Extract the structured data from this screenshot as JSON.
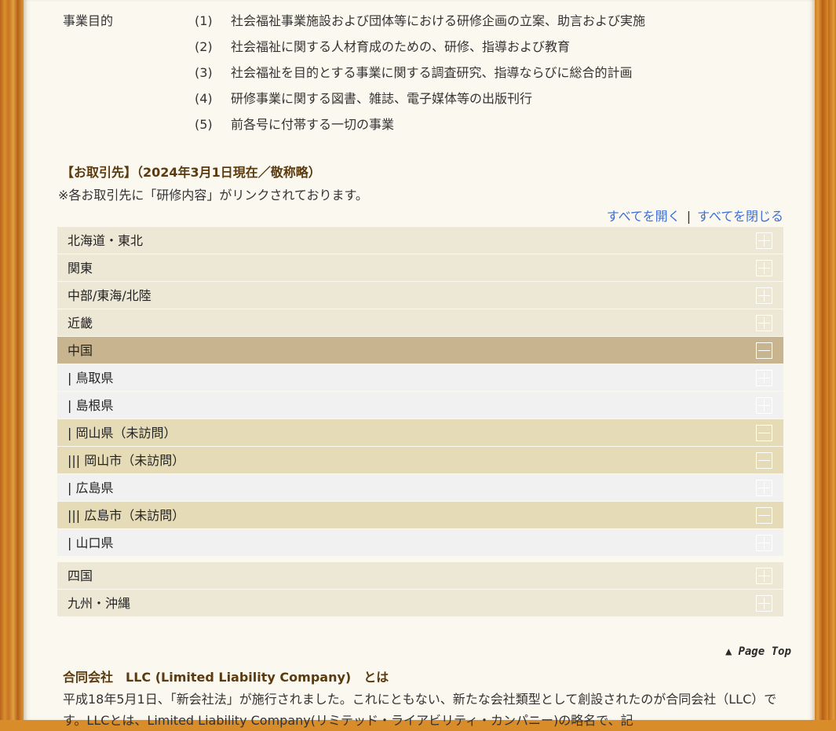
{
  "business": {
    "label": "事業目的",
    "items": [
      {
        "num": "(1)",
        "text": "社会福祉事業施設および団体等における研修企画の立案、助言および実施"
      },
      {
        "num": "(2)",
        "text": "社会福祉に関する人材育成のための、研修、指導および教育"
      },
      {
        "num": "(3)",
        "text": "社会福祉を目的とする事業に関する調査研究、指導ならびに総合的計画"
      },
      {
        "num": "(4)",
        "text": "研修事業に関する図書、雑誌、電子媒体等の出版刊行"
      },
      {
        "num": "(5)",
        "text": "前各号に付帯する一切の事業"
      }
    ]
  },
  "partners": {
    "title": "【お取引先】（2024年3月1日現在／敬称略）",
    "note": "※各お取引先に「研修内容」がリンクされております。",
    "open_all": "すべてを開く",
    "separator": "|",
    "close_all": "すべてを閉じる"
  },
  "accordion": [
    {
      "label": "北海道・東北",
      "kind": "region",
      "state": "closed"
    },
    {
      "label": "関東",
      "kind": "region",
      "state": "closed"
    },
    {
      "label": "中部/東海/北陸",
      "kind": "region",
      "state": "closed"
    },
    {
      "label": "近畿",
      "kind": "region",
      "state": "closed"
    },
    {
      "label": "中国",
      "kind": "open",
      "state": "open"
    },
    {
      "label": "| 鳥取県",
      "kind": "pref",
      "state": "closed"
    },
    {
      "label": "| 島根県",
      "kind": "pref",
      "state": "closed"
    },
    {
      "label": "| 岡山県（未訪問）",
      "kind": "pref-open",
      "state": "open"
    },
    {
      "label": "||| 岡山市（未訪問）",
      "kind": "pref-open",
      "state": "open"
    },
    {
      "label": "| 広島県",
      "kind": "pref",
      "state": "closed"
    },
    {
      "label": "||| 広島市（未訪問）",
      "kind": "pref-open",
      "state": "open"
    },
    {
      "label": "| 山口県",
      "kind": "pref",
      "state": "closed"
    },
    {
      "label": "四国",
      "kind": "region gap",
      "state": "closed"
    },
    {
      "label": "九州・沖縄",
      "kind": "region",
      "state": "closed"
    }
  ],
  "page_top": {
    "arrow": "▲",
    "label": "Page Top"
  },
  "llc": {
    "title": "合同会社　LLC (Limited Liability Company)　とは",
    "body": "平成18年5月1日、「新会社法」が施行されました。これにともない、新たな会社類型として創設されたのが合同会社（LLC）です。LLCとは、Limited Liability Company(リミテッド・ライアビリティ・カンパニー)の略名で、記"
  }
}
